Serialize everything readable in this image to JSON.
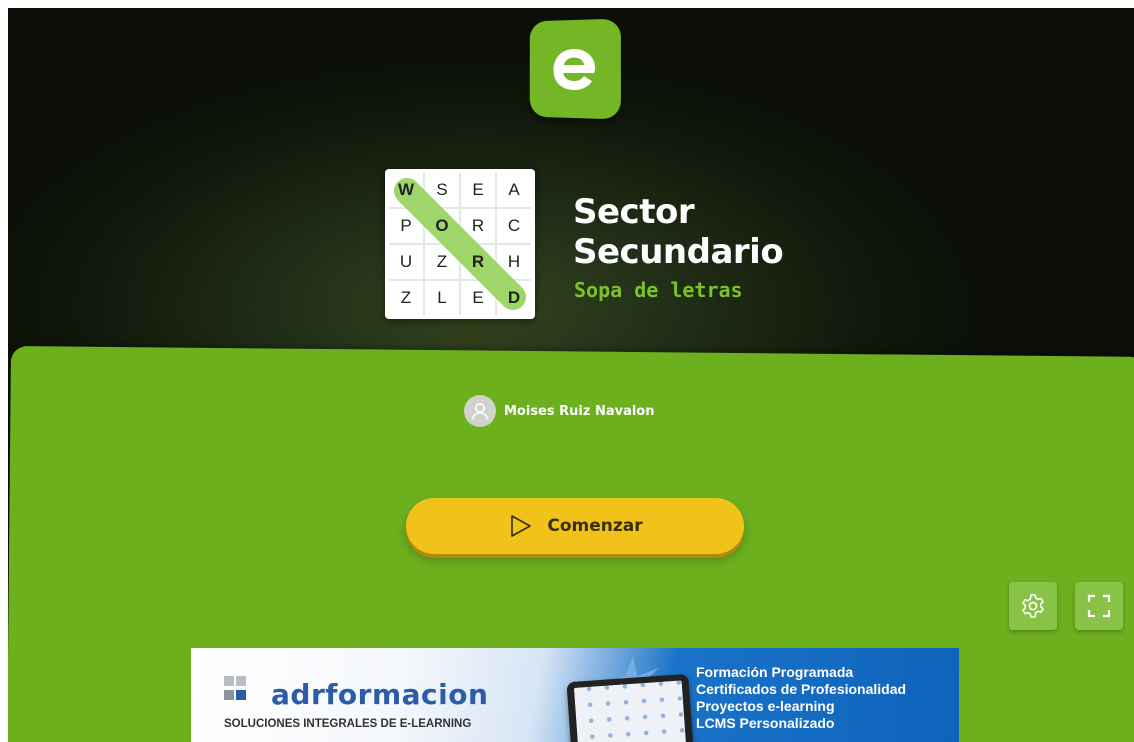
{
  "header": {
    "logo_letter": "e",
    "title_line1": "Sector",
    "title_line2": "Secundario",
    "subtitle": "Sopa de letras"
  },
  "grid": {
    "rows": [
      [
        "W",
        "S",
        "E",
        "A"
      ],
      [
        "P",
        "O",
        "R",
        "C"
      ],
      [
        "U",
        "Z",
        "R",
        "H"
      ],
      [
        "Z",
        "L",
        "E",
        "D"
      ]
    ]
  },
  "author": {
    "name": "Moises Ruiz Navalon"
  },
  "actions": {
    "start_label": "Comenzar",
    "settings_icon": "gear-icon",
    "fullscreen_icon": "fullscreen-icon"
  },
  "banner": {
    "brand": "adrformacion",
    "tagline": "SOLUCIONES INTEGRALES DE E-LEARNING",
    "lines": [
      "Formación Programada",
      "Certificados de Profesionalidad",
      "Proyectos e-learning",
      "LCMS Personalizado"
    ]
  },
  "colors": {
    "accent_green": "#6db01e",
    "logo_green": "#74b726",
    "button_yellow": "#f0c21a",
    "subtitle_green": "#7cc22a",
    "banner_blue": "#0e63bb"
  }
}
